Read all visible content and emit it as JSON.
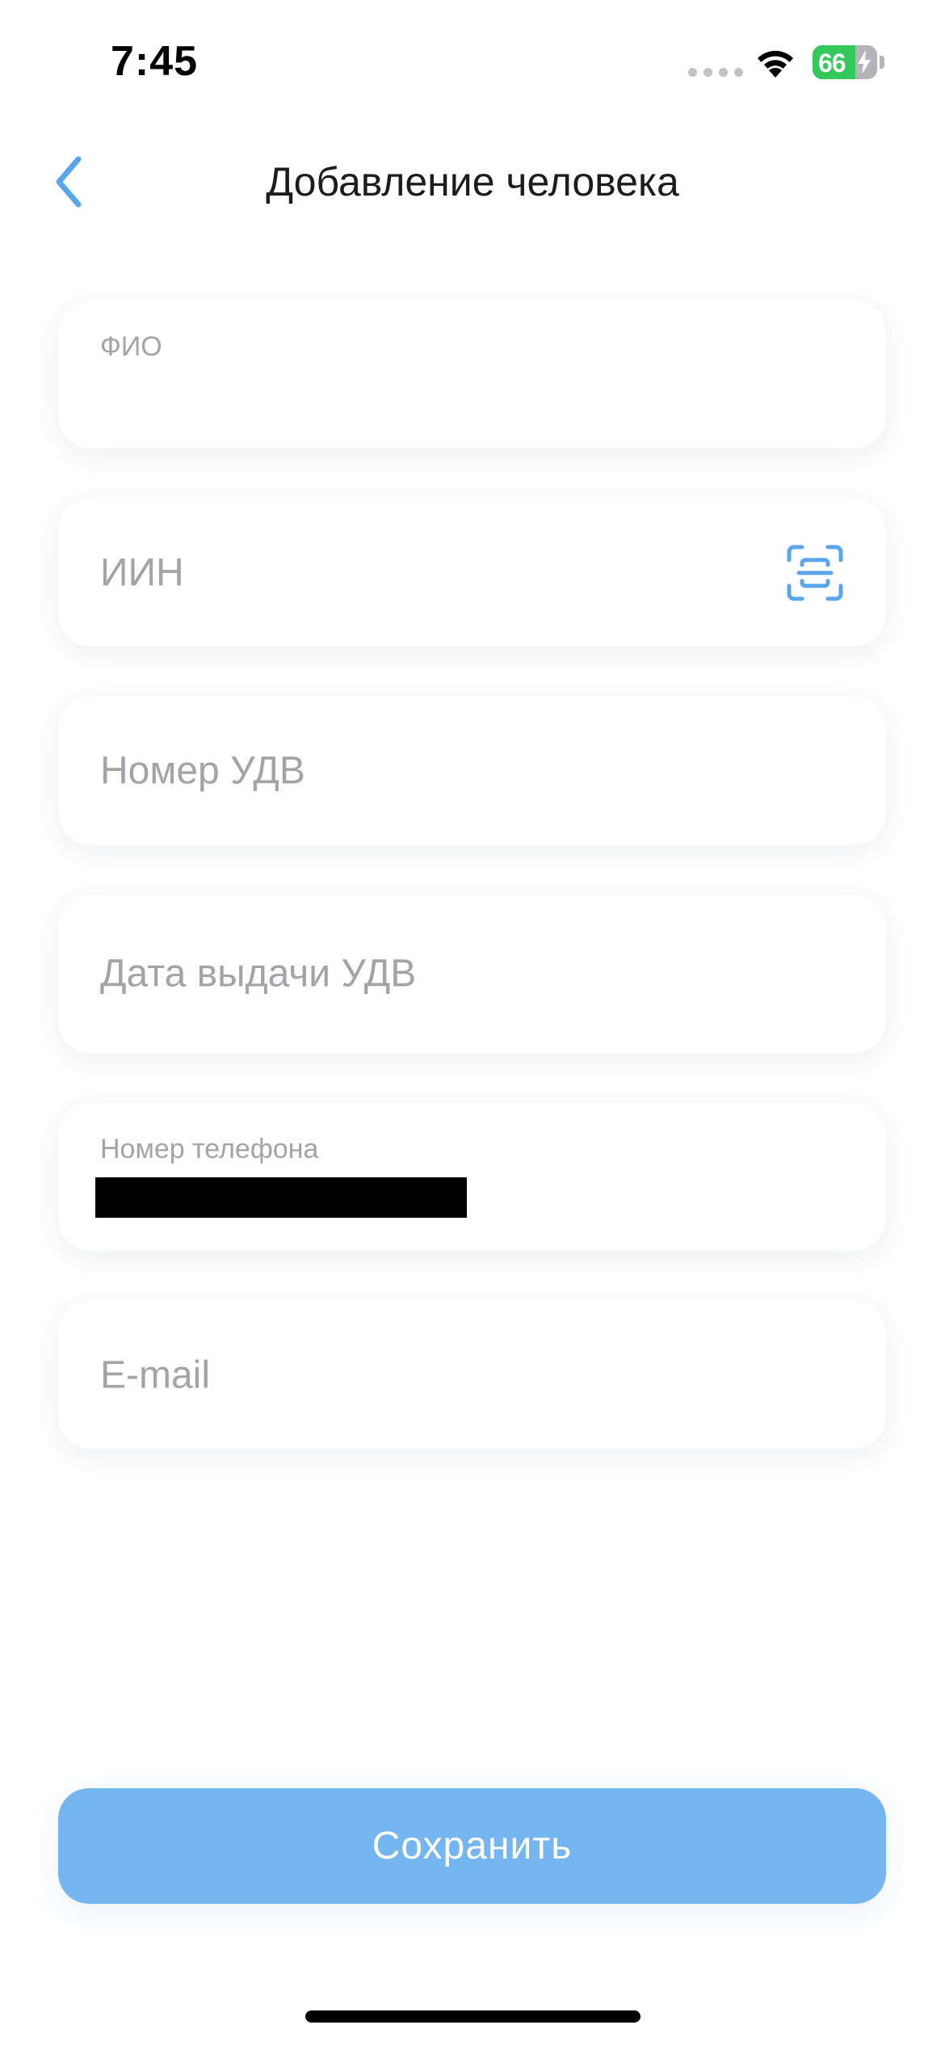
{
  "status_bar": {
    "time": "7:45",
    "battery_level": 66,
    "battery_text": "66",
    "battery_color": "#34c759"
  },
  "nav": {
    "back_icon": "chevron-left-icon",
    "title": "Добавление человека",
    "accent_color": "#5aa6ec"
  },
  "form": {
    "full_name": {
      "label": "ФИО",
      "value": ""
    },
    "iin": {
      "placeholder": "ИИН",
      "action_icon": "scan-icon"
    },
    "id_number": {
      "placeholder": "Номер УДВ"
    },
    "id_issue_date": {
      "placeholder": "Дата выдачи УДВ"
    },
    "phone": {
      "label": "Номер телефона",
      "value_redacted": true
    },
    "email": {
      "placeholder": "E-mail"
    }
  },
  "save_button": {
    "label": "Сохранить",
    "color": "#76b6f0"
  }
}
